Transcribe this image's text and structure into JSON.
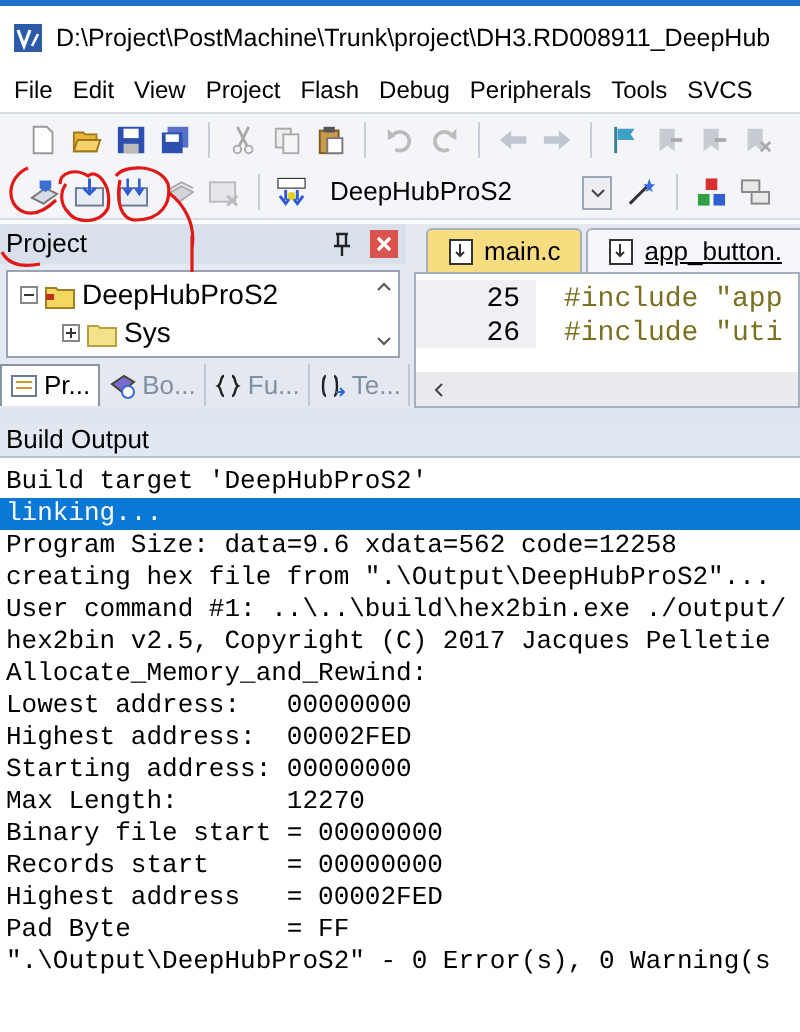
{
  "window": {
    "title": "D:\\Project\\PostMachine\\Trunk\\project\\DH3.RD008911_DeepHub"
  },
  "menu": [
    "File",
    "Edit",
    "View",
    "Project",
    "Flash",
    "Debug",
    "Peripherals",
    "Tools",
    "SVCS"
  ],
  "toolbar": {
    "target": "DeepHubProS2"
  },
  "project_panel": {
    "title": "Project",
    "tree": [
      {
        "label": "DeepHubProS2",
        "expanded": true,
        "children": [
          {
            "label": "Sys",
            "expanded": false
          }
        ]
      }
    ],
    "tabs": [
      {
        "label": "Pr...",
        "selected": true
      },
      {
        "label": "Bo...",
        "selected": false
      },
      {
        "label": "Fu...",
        "selected": false
      },
      {
        "label": "Te...",
        "selected": false
      }
    ]
  },
  "editor": {
    "tabs": [
      {
        "label": "main.c",
        "selected": true
      },
      {
        "label": "app_button.",
        "selected": false
      }
    ],
    "lines": [
      {
        "number": "25",
        "code": "#include \"app"
      },
      {
        "number": "26",
        "code": "#include \"uti"
      }
    ]
  },
  "build_output": {
    "title": "Build Output",
    "lines": [
      {
        "text": "Build target 'DeepHubProS2'",
        "selected": false
      },
      {
        "text": "linking...",
        "selected": true
      },
      {
        "text": "Program Size: data=9.6 xdata=562 code=12258",
        "selected": false
      },
      {
        "text": "creating hex file from \".\\Output\\DeepHubProS2\"...",
        "selected": false
      },
      {
        "text": "User command #1: ..\\..\\build\\hex2bin.exe ./output/",
        "selected": false
      },
      {
        "text": "hex2bin v2.5, Copyright (C) 2017 Jacques Pelletie",
        "selected": false
      },
      {
        "text": "Allocate_Memory_and_Rewind:",
        "selected": false
      },
      {
        "text": "Lowest address:   00000000",
        "selected": false
      },
      {
        "text": "Highest address:  00002FED",
        "selected": false
      },
      {
        "text": "Starting address: 00000000",
        "selected": false
      },
      {
        "text": "Max Length:       12270",
        "selected": false
      },
      {
        "text": "Binary file start = 00000000",
        "selected": false
      },
      {
        "text": "Records start     = 00000000",
        "selected": false
      },
      {
        "text": "Highest address   = 00002FED",
        "selected": false
      },
      {
        "text": "Pad Byte          = FF",
        "selected": false
      },
      {
        "text": "\".\\Output\\DeepHubProS2\" - 0 Error(s), 0 Warning(s",
        "selected": false
      }
    ]
  }
}
